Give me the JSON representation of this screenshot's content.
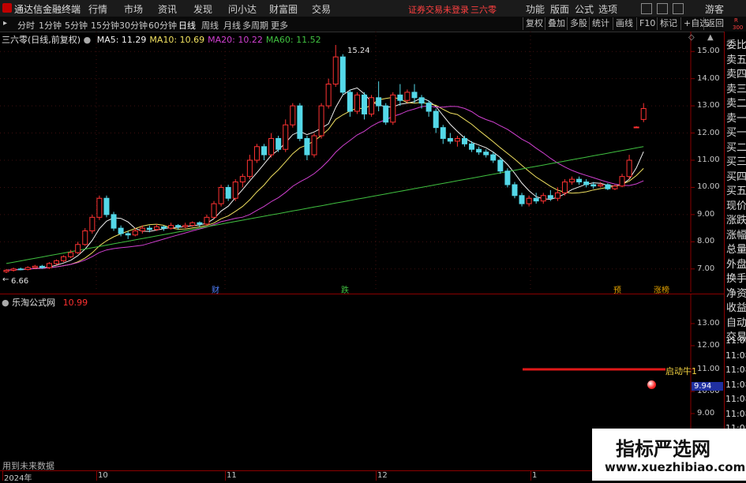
{
  "app": {
    "logo_text": "通达信金融终端",
    "notice": "证券交易未登录",
    "stock_name": "三六零",
    "guest": "游客"
  },
  "menu": [
    "行情",
    "市场",
    "资讯",
    "发现",
    "问小达",
    "财富圈",
    "交易"
  ],
  "menu_right": [
    "功能",
    "版面",
    "公式",
    "选项"
  ],
  "periods": [
    "分时",
    "1分钟",
    "5分钟",
    "15分钟",
    "30分钟",
    "60分钟",
    "日线",
    "周线",
    "月线",
    "多周期",
    "更多"
  ],
  "active_period": "日线",
  "tools": [
    "复权",
    "叠加",
    "多股",
    "统计",
    "画线",
    "F10",
    "标记",
    "+自选",
    "返回"
  ],
  "ma_legend": {
    "title": "三六零(日线,前复权)",
    "items": [
      {
        "label": "MA5: 11.29",
        "color": "#f0f0f0"
      },
      {
        "label": "MA10: 10.69",
        "color": "#f0e060"
      },
      {
        "label": "MA20: 10.22",
        "color": "#d040d0"
      },
      {
        "label": "MA60: 11.52",
        "color": "#40c040"
      }
    ]
  },
  "price_axis": [
    "15.00",
    "14.00",
    "13.00",
    "12.00",
    "11.00",
    "10.00",
    "9.00",
    "8.00",
    "7.00"
  ],
  "annotations": {
    "high": "15.24",
    "low": "6.66"
  },
  "event_tags": [
    {
      "text": "财",
      "color": "#5080ff"
    },
    {
      "text": "跌",
      "color": "#40c040"
    },
    {
      "text": "预",
      "color": "#e0a000"
    },
    {
      "text": "涨榜",
      "color": "#e0a000"
    }
  ],
  "right_panel": [
    "委比",
    "卖五",
    "卖四",
    "卖三",
    "卖二",
    "卖一",
    "买一",
    "买二",
    "买三",
    "买四",
    "买五",
    "现价",
    "涨跌",
    "涨幅",
    "总量",
    "外盘",
    "换手",
    "净资",
    "收益",
    "自动",
    "交易"
  ],
  "right_panel_top": [
    "R",
    "300"
  ],
  "indicator": {
    "name": "乐淘公式网",
    "value": "10.99",
    "axis": [
      "13.00",
      "12.00",
      "11.00",
      "10.00",
      "9.00"
    ],
    "signal_label": "启动牛1",
    "current_value": "9.94"
  },
  "side_numbers": [
    "11:08",
    "11:08",
    "11:08",
    "11:08",
    "11:08",
    "11:08",
    "11:08",
    "11:08",
    "11:08"
  ],
  "footer": {
    "note": "用到未来数据"
  },
  "date_axis": [
    "2024年",
    "10",
    "11",
    "12",
    "1"
  ],
  "watermark": {
    "title": "指标严选网",
    "url": "www.xuezhibiao.com"
  },
  "chart_data": {
    "type": "candlestick",
    "ylim": [
      6.5,
      15.5
    ],
    "candles": [
      [
        6.9,
        6.95,
        6.85,
        7.0
      ],
      [
        6.95,
        7.0,
        6.9,
        7.05
      ],
      [
        7.0,
        6.98,
        6.95,
        7.05
      ],
      [
        6.98,
        7.05,
        6.95,
        7.1
      ],
      [
        7.05,
        7.1,
        7.0,
        7.15
      ],
      [
        7.1,
        7.05,
        7.0,
        7.15
      ],
      [
        7.05,
        7.2,
        7.0,
        7.25
      ],
      [
        7.2,
        7.3,
        7.15,
        7.35
      ],
      [
        7.3,
        7.45,
        7.25,
        7.5
      ],
      [
        7.45,
        7.6,
        7.4,
        7.7
      ],
      [
        7.6,
        7.9,
        7.55,
        8.0
      ],
      [
        7.9,
        8.4,
        7.85,
        8.5
      ],
      [
        8.4,
        8.9,
        8.3,
        9.0
      ],
      [
        8.9,
        9.6,
        8.8,
        9.7
      ],
      [
        9.6,
        9.0,
        8.9,
        9.7
      ],
      [
        9.0,
        8.5,
        8.4,
        9.1
      ],
      [
        8.5,
        8.3,
        8.2,
        8.6
      ],
      [
        8.3,
        8.25,
        8.1,
        8.4
      ],
      [
        8.25,
        8.4,
        8.2,
        8.5
      ],
      [
        8.4,
        8.5,
        8.3,
        8.6
      ],
      [
        8.5,
        8.45,
        8.35,
        8.6
      ],
      [
        8.45,
        8.55,
        8.4,
        8.65
      ],
      [
        8.55,
        8.5,
        8.4,
        8.6
      ],
      [
        8.5,
        8.6,
        8.45,
        8.7
      ],
      [
        8.6,
        8.55,
        8.45,
        8.65
      ],
      [
        8.55,
        8.6,
        8.5,
        8.7
      ],
      [
        8.6,
        8.7,
        8.55,
        8.75
      ],
      [
        8.7,
        8.65,
        8.55,
        8.75
      ],
      [
        8.65,
        8.9,
        8.6,
        9.0
      ],
      [
        8.9,
        9.4,
        8.85,
        9.5
      ],
      [
        9.4,
        10.0,
        9.3,
        10.1
      ],
      [
        10.0,
        9.6,
        9.5,
        10.1
      ],
      [
        9.6,
        10.2,
        9.5,
        10.3
      ],
      [
        10.2,
        10.4,
        10.0,
        10.5
      ],
      [
        10.4,
        11.0,
        10.3,
        11.2
      ],
      [
        11.0,
        11.5,
        10.9,
        11.6
      ],
      [
        11.5,
        11.2,
        11.0,
        11.6
      ],
      [
        11.2,
        11.8,
        11.1,
        12.0
      ],
      [
        11.8,
        11.4,
        11.3,
        11.9
      ],
      [
        11.4,
        12.3,
        11.3,
        12.5
      ],
      [
        12.3,
        13.0,
        12.2,
        13.1
      ],
      [
        13.0,
        11.8,
        11.7,
        13.1
      ],
      [
        11.8,
        11.2,
        11.0,
        11.9
      ],
      [
        11.2,
        11.9,
        11.1,
        12.0
      ],
      [
        11.9,
        13.0,
        11.8,
        13.1
      ],
      [
        13.0,
        13.8,
        12.9,
        14.0
      ],
      [
        13.8,
        14.8,
        13.7,
        15.24
      ],
      [
        14.8,
        13.5,
        13.4,
        14.9
      ],
      [
        13.5,
        12.8,
        12.6,
        13.6
      ],
      [
        12.8,
        13.4,
        12.7,
        13.5
      ],
      [
        13.4,
        12.7,
        12.5,
        13.5
      ],
      [
        12.7,
        13.3,
        12.6,
        13.4
      ],
      [
        13.3,
        13.0,
        12.8,
        13.9
      ],
      [
        13.0,
        12.4,
        12.3,
        13.1
      ],
      [
        12.4,
        13.4,
        12.3,
        13.5
      ],
      [
        13.4,
        13.2,
        13.0,
        13.8
      ],
      [
        13.2,
        13.5,
        13.1,
        13.6
      ],
      [
        13.5,
        13.3,
        13.1,
        13.8
      ],
      [
        13.3,
        13.1,
        12.9,
        13.4
      ],
      [
        13.1,
        12.8,
        12.6,
        13.2
      ],
      [
        12.8,
        12.2,
        12.0,
        12.9
      ],
      [
        12.2,
        11.8,
        11.6,
        12.3
      ],
      [
        11.8,
        11.7,
        11.6,
        12.0
      ],
      [
        11.7,
        11.8,
        11.5,
        11.9
      ],
      [
        11.8,
        11.6,
        11.5,
        11.9
      ],
      [
        11.6,
        11.4,
        11.3,
        11.7
      ],
      [
        11.4,
        11.3,
        11.2,
        11.5
      ],
      [
        11.3,
        11.2,
        11.1,
        11.4
      ],
      [
        11.2,
        11.0,
        10.9,
        11.3
      ],
      [
        11.0,
        10.6,
        10.5,
        11.1
      ],
      [
        10.6,
        10.1,
        10.0,
        10.7
      ],
      [
        10.1,
        9.7,
        9.6,
        10.2
      ],
      [
        9.7,
        9.4,
        9.3,
        9.8
      ],
      [
        9.4,
        9.6,
        9.3,
        9.7
      ],
      [
        9.6,
        9.5,
        9.4,
        9.8
      ],
      [
        9.5,
        9.7,
        9.4,
        9.8
      ],
      [
        9.7,
        9.6,
        9.5,
        9.9
      ],
      [
        9.6,
        9.8,
        9.5,
        10.0
      ],
      [
        9.8,
        10.2,
        9.7,
        10.3
      ],
      [
        10.2,
        10.3,
        10.1,
        10.4
      ],
      [
        10.3,
        10.2,
        10.1,
        10.4
      ],
      [
        10.2,
        10.1,
        10.0,
        10.3
      ],
      [
        10.1,
        10.05,
        9.95,
        10.2
      ],
      [
        10.05,
        10.1,
        10.0,
        10.2
      ],
      [
        10.1,
        9.95,
        9.9,
        10.15
      ],
      [
        9.95,
        10.05,
        9.9,
        10.1
      ],
      [
        10.05,
        10.4,
        10.0,
        10.5
      ],
      [
        10.4,
        11.0,
        10.3,
        11.2
      ],
      [
        12.2,
        12.22,
        12.2,
        12.25
      ],
      [
        12.5,
        12.9,
        12.4,
        13.1
      ]
    ]
  }
}
